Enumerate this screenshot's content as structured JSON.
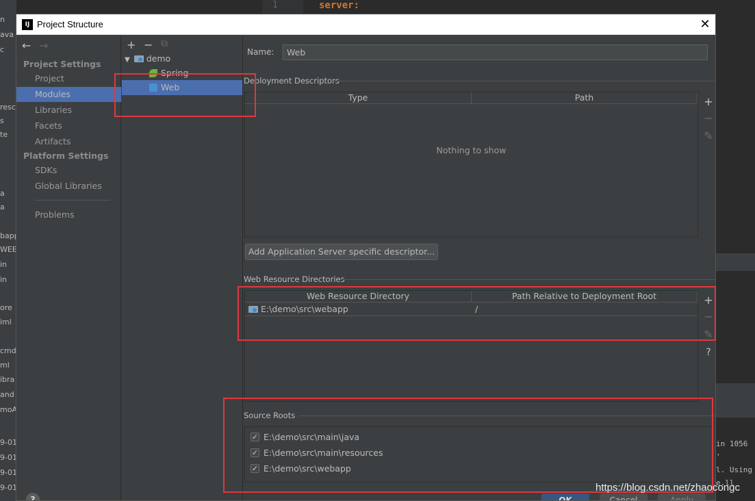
{
  "background": {
    "line_number": "1",
    "code": "server:",
    "left_fragments": [
      "n",
      "ava",
      "c",
      "",
      "",
      "resc",
      "s",
      "te",
      "",
      "",
      "a",
      "a",
      "",
      "bapp",
      "WEB",
      "in",
      "in",
      "ore",
      "iml",
      "cmd",
      "ml",
      "ibra",
      "and",
      "moAp",
      "",
      "9-01",
      "9-01",
      "9-01",
      "9-01"
    ],
    "console_lines": [
      "in 1056",
      "'",
      "l. Using",
      "e.ll"
    ]
  },
  "dialog": {
    "title": "Project Structure",
    "close_label": "✕",
    "nav": {
      "back": "←",
      "forward": "→",
      "project_settings": "Project Settings",
      "items_project": [
        "Project",
        "Modules",
        "Libraries",
        "Facets",
        "Artifacts"
      ],
      "platform_settings": "Platform Settings",
      "items_platform": [
        "SDKs",
        "Global Libraries"
      ],
      "problems": "Problems",
      "help": "?"
    },
    "tree": {
      "add": "+",
      "remove": "−",
      "copy": "⧉",
      "root": "demo",
      "children": [
        "Spring",
        "Web"
      ]
    },
    "panel": {
      "name_label": "Name:",
      "name_value": "Web",
      "deployment_title": "Deployment Descriptors",
      "deployment_cols": [
        "Type",
        "Path"
      ],
      "deployment_empty": "Nothing to show",
      "add_server_btn": "Add Application Server specific descriptor...",
      "web_res_title": "Web Resource Directories",
      "web_res_cols": [
        "Web Resource Directory",
        "Path Relative to Deployment Root"
      ],
      "web_res_rows": [
        {
          "dir": "E:\\demo\\src\\webapp",
          "path": "/"
        }
      ],
      "source_roots_title": "Source Roots",
      "source_roots": [
        "E:\\demo\\src\\main\\java",
        "E:\\demo\\src\\main\\resources",
        "E:\\demo\\src\\webapp"
      ],
      "tool_add": "+",
      "tool_remove": "−",
      "tool_edit": "✎",
      "tool_help": "?"
    },
    "footer": {
      "ok": "OK",
      "cancel": "Cancel",
      "apply": "Apply"
    }
  },
  "watermark": "https://blog.csdn.net/zhaocongc",
  "colors": {
    "selection": "#4b6eaf",
    "highlight_box": "#e0383e",
    "dialog_bg": "#3c3f41"
  }
}
